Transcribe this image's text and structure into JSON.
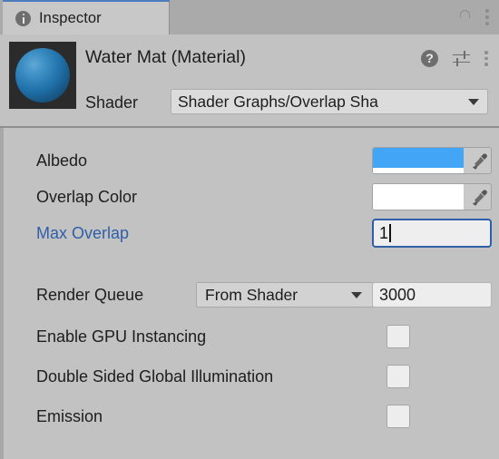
{
  "window": {
    "tab_label": "Inspector",
    "tab_icon": "info-icon",
    "lock_icon": "lock-open-icon",
    "menu_icon": "kebab-menu-icon",
    "accent_color": "#4c7ebf",
    "background": "#c2c2c2",
    "tabbar_background": "#aaaaaa"
  },
  "header": {
    "title": "Water Mat  (Material)",
    "preview_icon": "material-preview-sphere",
    "preview_color": "#2b8fd0",
    "help_icon": "help-icon",
    "preset_icon": "preset-settings-icon",
    "menu_icon": "kebab-menu-icon",
    "shader_label": "Shader",
    "shader_value": "Shader Graphs/Overlap Sha",
    "shader_caret": "chevron-down-icon"
  },
  "properties": [
    {
      "label": "Albedo",
      "type": "color",
      "color": "#42a5f5",
      "alpha_color": "#ffffff",
      "eyedropper_icon": "eyedropper-icon",
      "modified": false
    },
    {
      "label": "Overlap Color",
      "type": "color",
      "color": "#ffffff",
      "alpha_color": "#ffffff",
      "eyedropper_icon": "eyedropper-icon",
      "modified": false
    },
    {
      "label": "Max Overlap",
      "type": "number-focused",
      "value": "1",
      "modified": true,
      "modified_color": "#2f5fa8"
    }
  ],
  "render_queue": {
    "label": "Render Queue",
    "mode": "From Shader",
    "caret": "chevron-down-icon",
    "value": "3000"
  },
  "toggles": [
    {
      "label": "Enable GPU Instancing",
      "checked": false
    },
    {
      "label": "Double Sided Global Illumination",
      "checked": false
    },
    {
      "label": "Emission",
      "checked": false
    }
  ]
}
